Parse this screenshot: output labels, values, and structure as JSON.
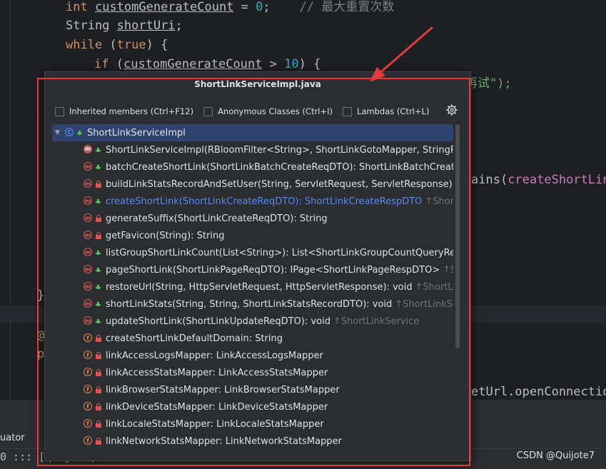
{
  "editor": {
    "lines": [
      {
        "id": "l1"
      },
      {
        "id": "l2"
      }
    ],
    "code": {
      "line1_kw": "int",
      "line1_var": "customGenerateCount",
      "line1_rest": " = ",
      "line1_num": "0",
      "line1_semi": ";",
      "line1_comment": "// 最大重置次数",
      "line2_type": "String ",
      "line2_var": "shortUri",
      "line2_semi": ";",
      "line3_kw": "while",
      "line3_open": " (",
      "line3_true": "true",
      "line3_close": ") {",
      "line4_kw": "if",
      "line4_open": " (",
      "line4_var": "customGenerateCount",
      "line4_op": " > ",
      "line4_num": "10",
      "line4_close": ") {",
      "frag_str": "再试\");",
      "frag_contains": "ains(",
      "frag_field": "createShortLinkD",
      "frag_brace": "}",
      "frag_at": "@",
      "frag_p": "p",
      "frag_open_conn": "etUrl.openConnection("
    }
  },
  "bottom": {
    "tab_label": "uator",
    "console_text": "0 ::: [quijote]",
    "watermark": "CSDN @Quijote7"
  },
  "popup": {
    "title": "ShortLinkServiceImpl.java",
    "filters": [
      {
        "label": "Inherited members (Ctrl+F12)",
        "checked": false
      },
      {
        "label": "Anonymous Classes (Ctrl+I)",
        "checked": false
      },
      {
        "label": "Lambdas (Ctrl+L)",
        "checked": false
      }
    ],
    "class_name": "ShortLinkServiceImpl",
    "items": [
      {
        "icon": "constructor-icon",
        "kind": "m",
        "visibility": "public",
        "label": "ShortLinkServiceImpl(RBloomFilter<String>, ShortLinkGotoMapper, StringRedisT",
        "hint": ""
      },
      {
        "icon": "method-icon",
        "kind": "m",
        "visibility": "public",
        "label": "batchCreateShortLink(ShortLinkBatchCreateReqDTO): ShortLinkBatchCreateRe",
        "hint": ""
      },
      {
        "icon": "method-icon",
        "kind": "m",
        "visibility": "private",
        "label": "buildLinkStatsRecordAndSetUser(String, ServletRequest, ServletResponse): Sh",
        "hint": ""
      },
      {
        "icon": "method-icon",
        "kind": "m",
        "visibility": "public",
        "label": "createShortLink(ShortLinkCreateReqDTO): ShortLinkCreateRespDTO",
        "hint": "↑ShortLin",
        "active": true
      },
      {
        "icon": "method-icon",
        "kind": "m",
        "visibility": "private",
        "label": "generateSuffix(ShortLinkCreateReqDTO): String",
        "hint": ""
      },
      {
        "icon": "method-icon",
        "kind": "m",
        "visibility": "private",
        "label": "getFavicon(String): String",
        "hint": ""
      },
      {
        "icon": "method-icon",
        "kind": "m",
        "visibility": "public",
        "label": "listGroupShortLinkCount(List<String>): List<ShortLinkGroupCountQueryRespD",
        "hint": ""
      },
      {
        "icon": "method-icon",
        "kind": "m",
        "visibility": "public",
        "label": "pageShortLink(ShortLinkPageReqDTO): IPage<ShortLinkPageRespDTO>",
        "hint": "↑Shor"
      },
      {
        "icon": "method-icon",
        "kind": "m",
        "visibility": "public",
        "label": "restoreUrl(String, HttpServletRequest, HttpServletResponse): void",
        "hint": "↑ShortLink"
      },
      {
        "icon": "method-icon",
        "kind": "m",
        "visibility": "public",
        "label": "shortLinkStats(String, String, ShortLinkStatsRecordDTO): void",
        "hint": "↑ShortLinkServic"
      },
      {
        "icon": "method-icon",
        "kind": "m",
        "visibility": "public",
        "label": "updateShortLink(ShortLinkUpdateReqDTO): void",
        "hint": "↑ShortLinkService"
      },
      {
        "icon": "field-icon",
        "kind": "f",
        "visibility": "private",
        "label": "createShortLinkDefaultDomain: String",
        "hint": ""
      },
      {
        "icon": "field-icon",
        "kind": "f",
        "visibility": "private",
        "label": "linkAccessLogsMapper: LinkAccessLogsMapper",
        "hint": ""
      },
      {
        "icon": "field-icon",
        "kind": "f",
        "visibility": "private",
        "label": "linkAccessStatsMapper: LinkAccessStatsMapper",
        "hint": ""
      },
      {
        "icon": "field-icon",
        "kind": "f",
        "visibility": "private",
        "label": "linkBrowserStatsMapper: LinkBrowserStatsMapper",
        "hint": ""
      },
      {
        "icon": "field-icon",
        "kind": "f",
        "visibility": "private",
        "label": "linkDeviceStatsMapper: LinkDeviceStatsMapper",
        "hint": ""
      },
      {
        "icon": "field-icon",
        "kind": "f",
        "visibility": "private",
        "label": "linkLocaleStatsMapper: LinkLocaleStatsMapper",
        "hint": ""
      },
      {
        "icon": "field-icon",
        "kind": "f",
        "visibility": "private",
        "label": "linkNetworkStatsMapper: LinkNetworkStatsMapper",
        "hint": ""
      }
    ]
  },
  "colors": {
    "annotation": "#e23b3b",
    "selection": "#2e436e",
    "active_link": "#548af7"
  }
}
